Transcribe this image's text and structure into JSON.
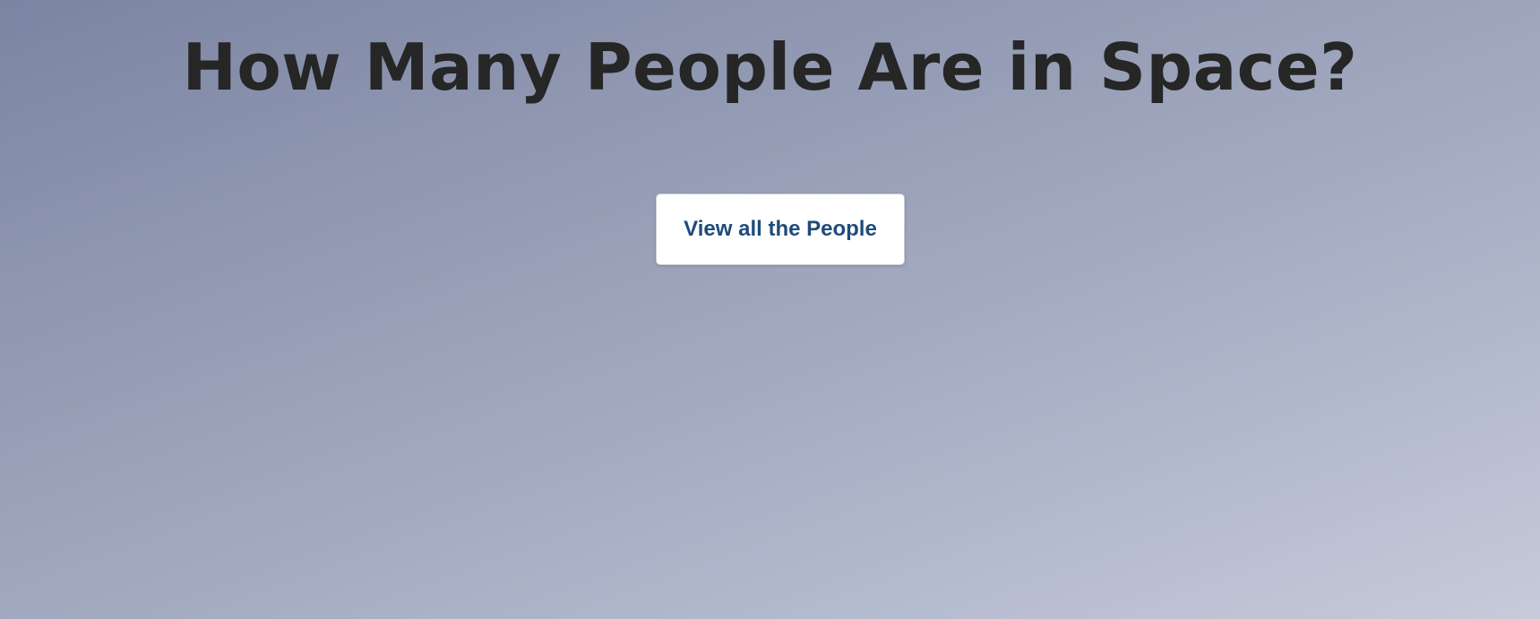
{
  "header": {
    "title": "How Many People Are in Space?"
  },
  "main": {
    "view_people_label": "View all the People"
  },
  "colors": {
    "title_text": "#262626",
    "button_text": "#1f4b7a",
    "button_background": "#ffffff",
    "background_gradient_start": "#7b84a2",
    "background_gradient_end": "#c6cbda"
  }
}
